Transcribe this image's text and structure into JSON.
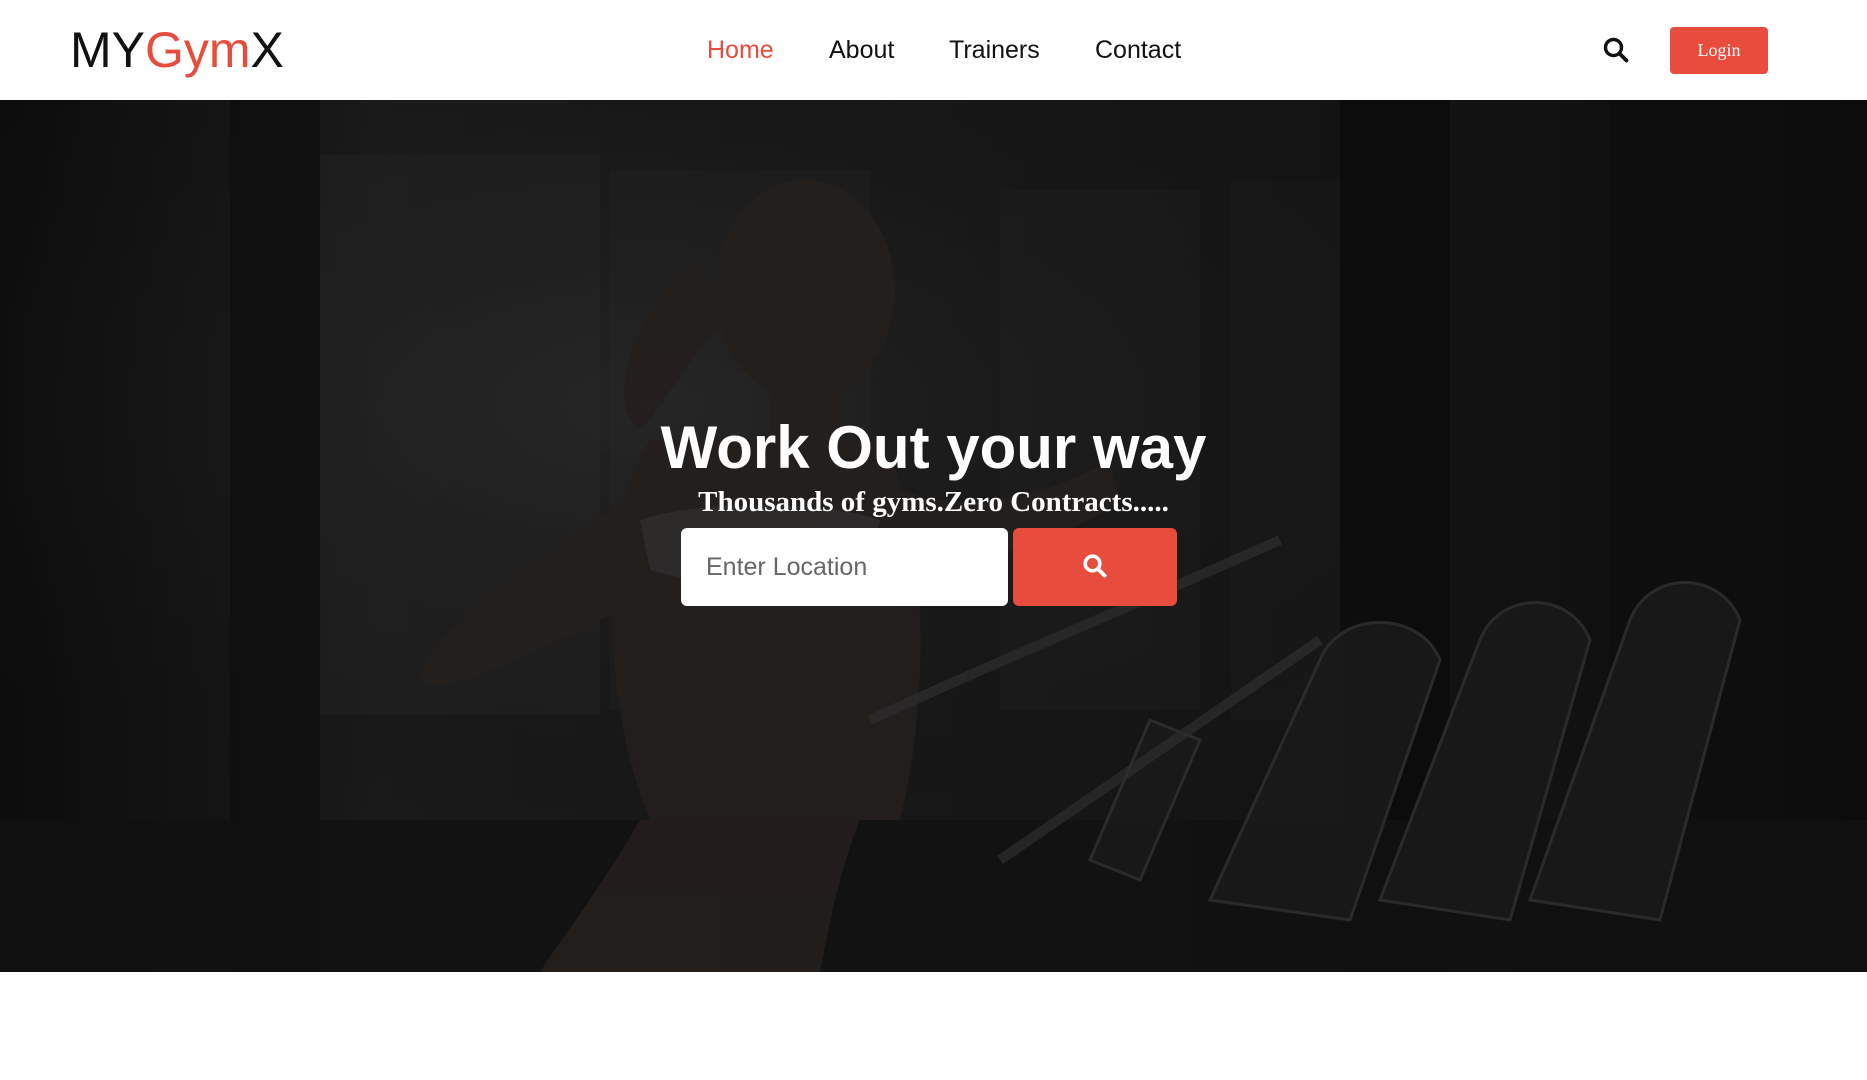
{
  "brand": {
    "logo_prefix": "MY",
    "logo_accent": "Gym",
    "logo_suffix": "X",
    "accent_color": "#e74c3c"
  },
  "nav": {
    "items": [
      {
        "label": "Home",
        "active": true
      },
      {
        "label": "About",
        "active": false
      },
      {
        "label": "Trainers",
        "active": false
      },
      {
        "label": "Contact",
        "active": false
      }
    ],
    "search_icon": "search-icon",
    "login_label": "Login"
  },
  "hero": {
    "title": "Work Out your way",
    "subtitle": "Thousands of gyms.Zero Contracts.....",
    "location_placeholder": "Enter Location",
    "location_value": "",
    "search_button_icon": "search-icon",
    "background": "woman-running-on-treadmill-photo"
  }
}
